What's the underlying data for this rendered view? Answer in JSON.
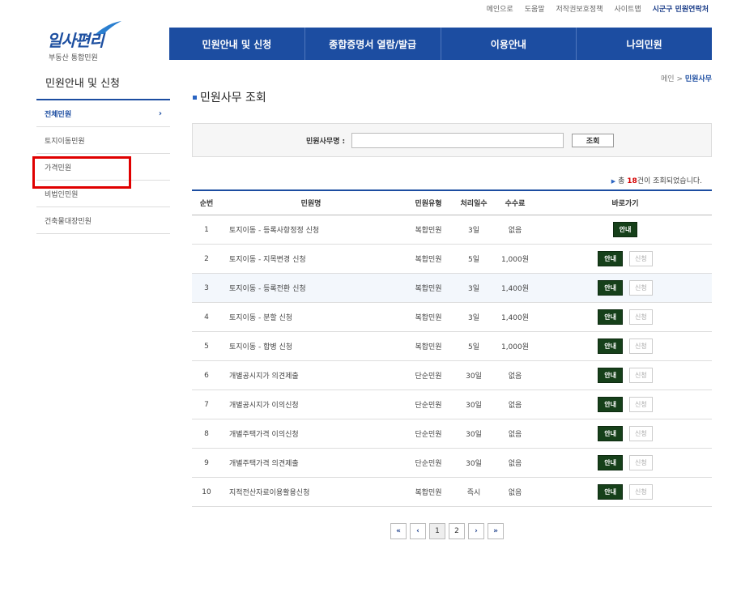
{
  "util_nav": [
    "메인으로",
    "도움말",
    "저작권보호정책",
    "사이트맵",
    "시군구 민원연락처"
  ],
  "logo": {
    "main": "일사편리",
    "sub": "부동산 통합민원"
  },
  "gnb": [
    "민원안내 및 신청",
    "종합증명서 열람/발급",
    "이용안내",
    "나의민원"
  ],
  "lnb": {
    "title": "민원안내 및 신청",
    "items": [
      "전체민원",
      "토지이동민원",
      "가격민원",
      "비법인민원",
      "건축물대장민원"
    ],
    "active_chevron": "›"
  },
  "breadcrumb": {
    "home": "메인",
    "sep": ">",
    "current": "민원사무"
  },
  "page_title": "민원사무 조회",
  "search": {
    "label": "민원사무명 :",
    "button": "조회",
    "value": ""
  },
  "result": {
    "prefix": "총",
    "count": "18",
    "suffix": "건이 조회되었습니다."
  },
  "table": {
    "headers": [
      "순번",
      "민원명",
      "민원유형",
      "처리일수",
      "수수료",
      "바로가기"
    ],
    "guide_label": "안내",
    "apply_label": "신청",
    "rows": [
      {
        "no": "1",
        "name": "토지이동 - 등록사항정정 신청",
        "type": "복합민원",
        "days": "3일",
        "fee": "없음",
        "apply": false
      },
      {
        "no": "2",
        "name": "토지이동 - 지목변경 신청",
        "type": "복합민원",
        "days": "5일",
        "fee": "1,000원",
        "apply": true
      },
      {
        "no": "3",
        "name": "토지이동 - 등록전환 신청",
        "type": "복합민원",
        "days": "3일",
        "fee": "1,400원",
        "apply": true
      },
      {
        "no": "4",
        "name": "토지이동 - 분할 신청",
        "type": "복합민원",
        "days": "3일",
        "fee": "1,400원",
        "apply": true
      },
      {
        "no": "5",
        "name": "토지이동 - 합병 신청",
        "type": "복합민원",
        "days": "5일",
        "fee": "1,000원",
        "apply": true
      },
      {
        "no": "6",
        "name": "개별공시지가 의견제출",
        "type": "단순민원",
        "days": "30일",
        "fee": "없음",
        "apply": true
      },
      {
        "no": "7",
        "name": "개별공시지가 이의신청",
        "type": "단순민원",
        "days": "30일",
        "fee": "없음",
        "apply": true
      },
      {
        "no": "8",
        "name": "개별주택가격 이의신청",
        "type": "단순민원",
        "days": "30일",
        "fee": "없음",
        "apply": true
      },
      {
        "no": "9",
        "name": "개별주택가격 의견제출",
        "type": "단순민원",
        "days": "30일",
        "fee": "없음",
        "apply": true
      },
      {
        "no": "10",
        "name": "지적전산자료이용활용신청",
        "type": "복합민원",
        "days": "즉시",
        "fee": "없음",
        "apply": true
      }
    ]
  },
  "pagination": {
    "first": "«",
    "prev": "‹",
    "pages": [
      "1",
      "2"
    ],
    "next": "›",
    "last": "»"
  },
  "colors": {
    "primary": "#1c4da1",
    "guide_button": "#16401a",
    "highlight": "#e00000",
    "count": "#d40000"
  }
}
